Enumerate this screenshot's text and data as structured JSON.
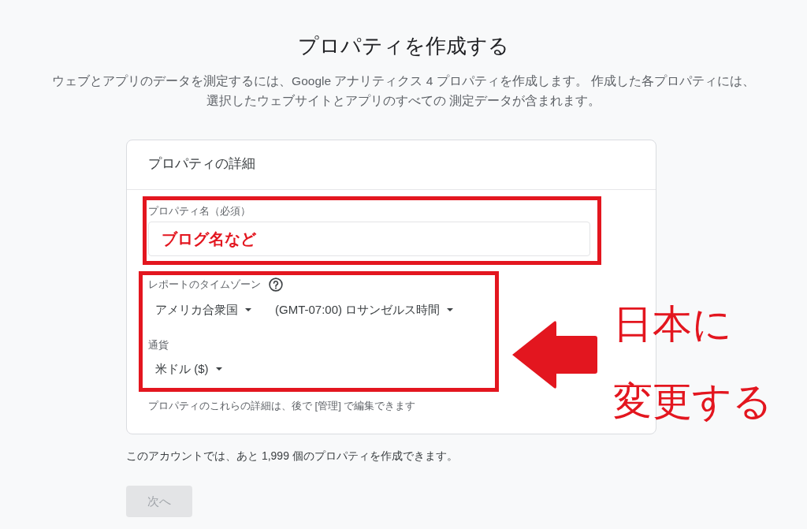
{
  "page": {
    "title": "プロパティを作成する",
    "description": "ウェブとアプリのデータを測定するには、Google アナリティクス 4 プロパティを作成します。 作成した各プロパティには、選択したウェブサイトとアプリのすべての 測定データが含まれます。"
  },
  "card": {
    "title": "プロパティの詳細",
    "property_name": {
      "label": "プロパティ名（必須）",
      "value": "ブログ名など"
    },
    "timezone": {
      "label": "レポートのタイムゾーン",
      "dropdowns": [
        "アメリカ合衆国",
        "(GMT-07:00) ロサンゼルス時間"
      ]
    },
    "currency": {
      "label": "通貨",
      "dropdowns": [
        "米ドル ($)"
      ]
    },
    "note": "プロパティのこれらの詳細は、後で [管理] で編集できます"
  },
  "callout": {
    "lines": [
      "日本に",
      "変更する"
    ]
  },
  "quota_text": "このアカウントでは、あと 1,999 個のプロパティを作成できます。",
  "next_button": {
    "label": "次へ",
    "disabled": true
  }
}
